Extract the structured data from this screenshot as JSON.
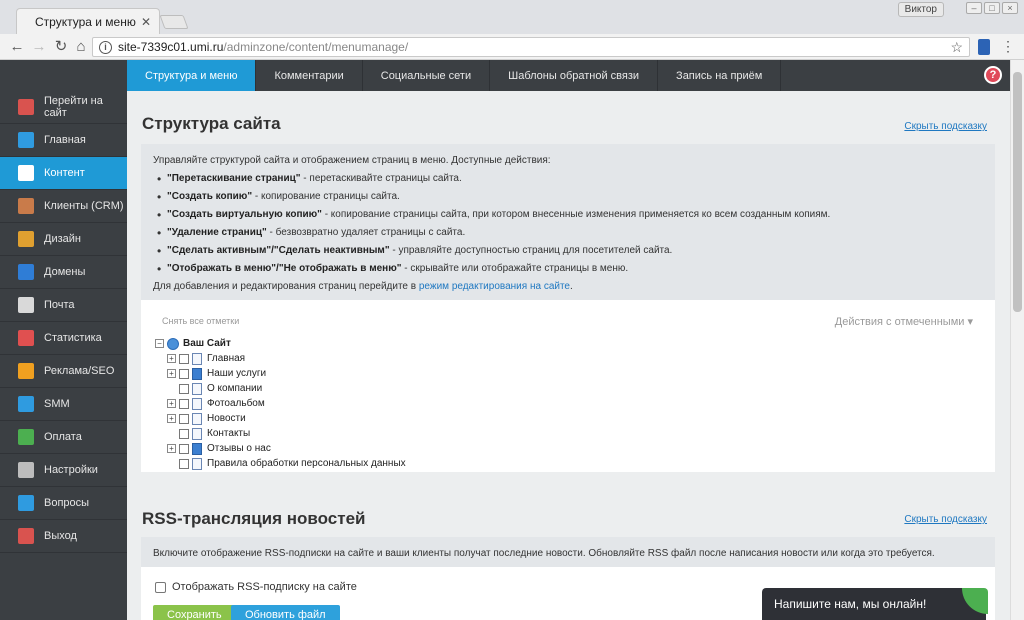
{
  "browser": {
    "tab_title": "Структура и меню",
    "tab_close": "✕",
    "user_chip": "Виктор",
    "url_host": "site-7339c01.umi.ru",
    "url_path": "/adminzone/content/menumanage/"
  },
  "topnav": [
    {
      "label": "Структура и меню",
      "active": true
    },
    {
      "label": "Комментарии"
    },
    {
      "label": "Социальные сети"
    },
    {
      "label": "Шаблоны обратной связи"
    },
    {
      "label": "Запись на приём"
    }
  ],
  "help_label": "?",
  "sidebar": [
    {
      "label": "Перейти на сайт",
      "icon": "home-icon",
      "color": "#d9534f"
    },
    {
      "label": "Главная",
      "icon": "butterfly-icon",
      "color": "#2f9be0"
    },
    {
      "label": "Контент",
      "icon": "document-icon",
      "color": "#ffffff",
      "active": true
    },
    {
      "label": "Клиенты (CRM)",
      "icon": "person-icon",
      "color": "#c97b4a"
    },
    {
      "label": "Дизайн",
      "icon": "palette-icon",
      "color": "#e0a030"
    },
    {
      "label": "Домены",
      "icon": "ru-domain-icon",
      "color": "#2f7dd6"
    },
    {
      "label": "Почта",
      "icon": "mail-icon",
      "color": "#d9d9d9"
    },
    {
      "label": "Статистика",
      "icon": "chart-icon",
      "color": "#e05050"
    },
    {
      "label": "Реклама/SEO",
      "icon": "bars-icon",
      "color": "#f0a020"
    },
    {
      "label": "SMM",
      "icon": "people-icon",
      "color": "#2f9be0"
    },
    {
      "label": "Оплата",
      "icon": "money-icon",
      "color": "#4caf50"
    },
    {
      "label": "Настройки",
      "icon": "gear-icon",
      "color": "#bdbdbd"
    },
    {
      "label": "Вопросы",
      "icon": "question-icon",
      "color": "#2f9be0"
    },
    {
      "label": "Выход",
      "icon": "power-icon",
      "color": "#d9534f"
    }
  ],
  "structure": {
    "title": "Структура сайта",
    "hide_hint": "Скрыть подсказку",
    "intro": "Управляйте структурой сайта и отображением страниц в меню. Доступные действия:",
    "bullets": [
      {
        "bold": "\"Перетаскивание страниц\"",
        "rest": " - перетаскивайте страницы сайта."
      },
      {
        "bold": "\"Создать копию\"",
        "rest": " - копирование страницы сайта."
      },
      {
        "bold": "\"Создать виртуальную копию\"",
        "rest": " - копирование страницы сайта, при котором внесенные изменения применяется ко всем созданным копиям."
      },
      {
        "bold": "\"Удаление страниц\"",
        "rest": " - безвозвратно удаляет страницы с сайта."
      },
      {
        "bold": "\"Сделать активным\"/\"Сделать неактивным\"",
        "rest": " - управляйте доступностью страниц для посетителей сайта."
      },
      {
        "bold": "\"Отображать в меню\"/\"Не отображать в меню\"",
        "rest": " - скрывайте или отображайте страницы в меню."
      }
    ],
    "footer_text": "Для добавления и редактирования страниц перейдите в ",
    "footer_link": "режим редактирования на сайте",
    "footer_end": ".",
    "uncheck_all": "Снять все отметки",
    "actions_dropdown": "Действия с отмеченными ▾",
    "root_label": "Ваш Сайт",
    "tree": [
      {
        "label": "Главная",
        "expandable": true,
        "blue": false
      },
      {
        "label": "Наши услуги",
        "expandable": true,
        "blue": true
      },
      {
        "label": "О компании",
        "expandable": false,
        "blue": false
      },
      {
        "label": "Фотоальбом",
        "expandable": true,
        "blue": false
      },
      {
        "label": "Новости",
        "expandable": true,
        "blue": false
      },
      {
        "label": "Контакты",
        "expandable": false,
        "blue": false
      },
      {
        "label": "Отзывы о нас",
        "expandable": true,
        "blue": true
      },
      {
        "label": "Правила обработки персональных данных",
        "expandable": false,
        "blue": false
      }
    ]
  },
  "rss": {
    "title": "RSS-трансляция новостей",
    "hide_hint": "Скрыть подсказку",
    "hint": "Включите отображение RSS-подписки на сайте и ваши клиенты получат последние новости. Обновляйте RSS файл после написания новости или когда это требуется.",
    "checkbox_label": "Отображать RSS-подписку на сайте",
    "save_label": "Сохранить",
    "update_label": "Обновить файл"
  },
  "chat": {
    "label": "Напишите нам, мы онлайн!"
  }
}
